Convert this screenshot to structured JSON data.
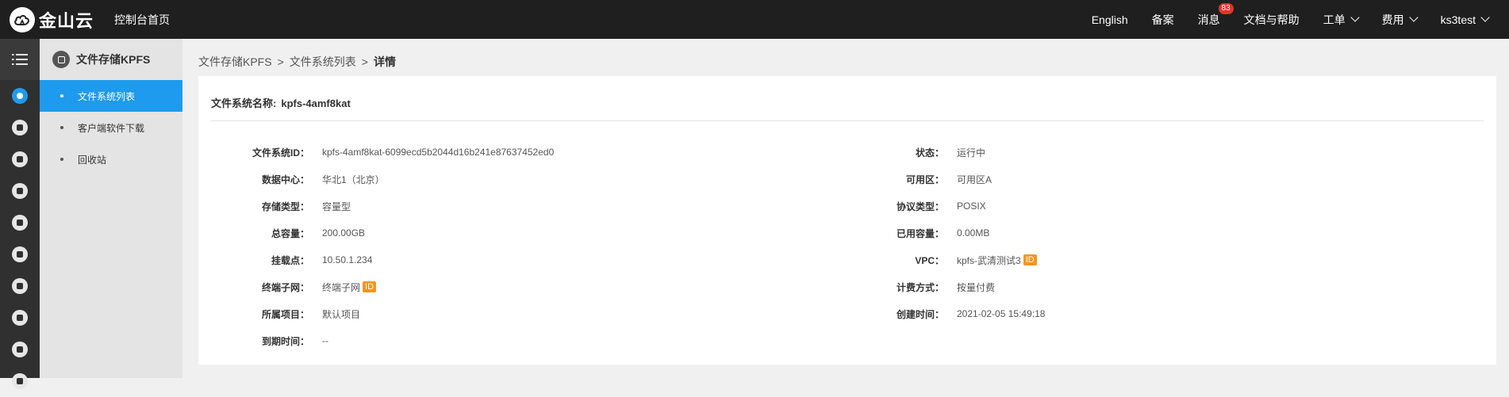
{
  "topbar": {
    "logo_text": "金山云",
    "console_home": "控制台首页",
    "links": {
      "english": "English",
      "beian": "备案",
      "messages": "消息",
      "messages_badge": "83",
      "docs": "文档与帮助",
      "tickets": "工单",
      "billing": "费用",
      "user": "ks3test"
    }
  },
  "sidebar": {
    "product_title": "文件存储KPFS",
    "items": [
      {
        "label": "文件系统列表"
      },
      {
        "label": "客户端软件下载"
      },
      {
        "label": "回收站"
      }
    ]
  },
  "breadcrumb": {
    "level1": "文件存储KPFS",
    "level2": "文件系统列表",
    "current": "详情",
    "separator": ">"
  },
  "detail": {
    "title_label": "文件系统名称:",
    "title_value": "kpfs-4amf8kat",
    "id_tag": "ID",
    "left": [
      {
        "label": "文件系统ID：",
        "value": "kpfs-4amf8kat-6099ecd5b2044d16b241e87637452ed0"
      },
      {
        "label": "数据中心：",
        "value": "华北1（北京）"
      },
      {
        "label": "存储类型：",
        "value": "容量型"
      },
      {
        "label": "总容量：",
        "value": "200.00GB"
      },
      {
        "label": "挂载点：",
        "value": "10.50.1.234"
      },
      {
        "label": "终端子网：",
        "value": "终端子网"
      },
      {
        "label": "所属项目：",
        "value": "默认项目"
      },
      {
        "label": "到期时间：",
        "value": "--"
      }
    ],
    "right": [
      {
        "label": "状态：",
        "value": "运行中"
      },
      {
        "label": "可用区：",
        "value": "可用区A"
      },
      {
        "label": "协议类型：",
        "value": "POSIX"
      },
      {
        "label": "已用容量：",
        "value": "0.00MB"
      },
      {
        "label": "VPC：",
        "value": "kpfs-武清测试3"
      },
      {
        "label": "计费方式：",
        "value": "按量付费"
      },
      {
        "label": "创建时间：",
        "value": "2021-02-05 15:49:18"
      }
    ]
  },
  "colors": {
    "topbar_bg": "#1f1f1f",
    "accent": "#1e9bee",
    "badge": "#e5322d",
    "id_tag": "#f7941e"
  }
}
